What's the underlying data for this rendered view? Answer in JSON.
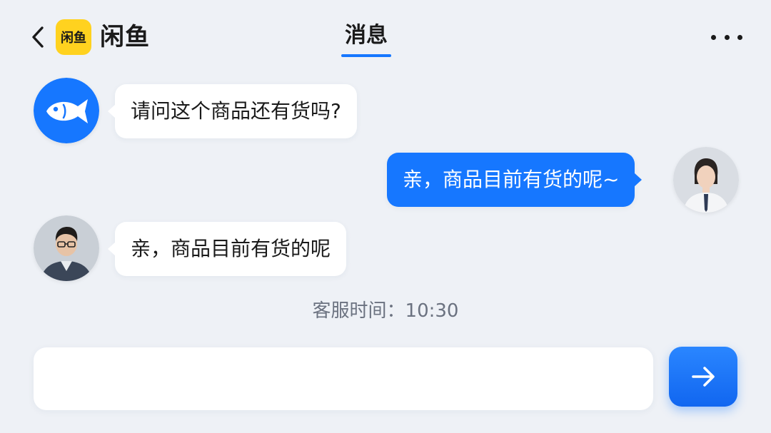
{
  "header": {
    "app_logo_text": "闲鱼",
    "app_name": "闲鱼",
    "title": "消息",
    "back_icon": "chevron-left-icon",
    "more_icon": "more-horizontal-icon"
  },
  "messages": [
    {
      "side": "left",
      "avatar": "fish-avatar",
      "text": "请问这个商品还有货吗?"
    },
    {
      "side": "right",
      "avatar": "female-agent-avatar",
      "text": "亲，商品目前有货的呢~"
    },
    {
      "side": "left",
      "avatar": "male-user-avatar",
      "text": "亲，商品目前有货的呢"
    }
  ],
  "timestamp": "客服时间：10:30",
  "input": {
    "value": "",
    "placeholder": "",
    "send_icon": "arrow-right-icon"
  },
  "colors": {
    "accent": "#1677ff",
    "logo_yellow": "#ffd21f",
    "background": "#eef1f6"
  }
}
